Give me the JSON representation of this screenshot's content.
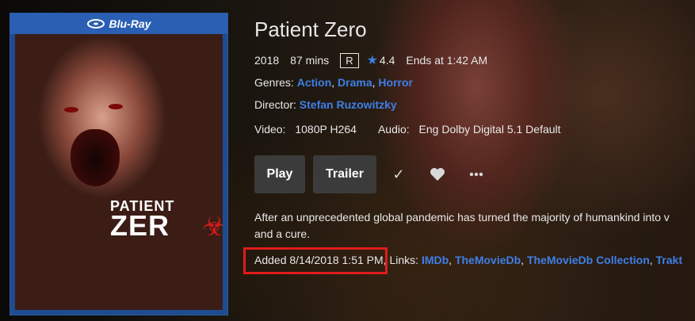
{
  "poster": {
    "format_label": "Blu-Ray",
    "title_line1": "PATIENT",
    "title_line2": "ZER"
  },
  "movie": {
    "title": "Patient Zero",
    "year": "2018",
    "runtime": "87 mins",
    "rating": "R",
    "community_rating": "4.4",
    "ends_at": "Ends at 1:42 AM",
    "genres_label": "Genres:",
    "genres": [
      "Action",
      "Drama",
      "Horror"
    ],
    "director_label": "Director:",
    "director": "Stefan Ruzowitzky",
    "video_label": "Video:",
    "video": "1080P H264",
    "audio_label": "Audio:",
    "audio": "Eng Dolby Digital 5.1 Default",
    "overview_line1": "After an unprecedented global pandemic has turned the majority of humankind into v",
    "overview_line2": "and a cure.",
    "added": "Added 8/14/2018 1:51 PM,",
    "links_label": "Links:",
    "links": [
      "IMDb",
      "TheMovieDb",
      "TheMovieDb Collection",
      "Trakt"
    ]
  },
  "actions": {
    "play_label": "Play",
    "trailer_label": "Trailer",
    "watched_icon": "checkmark-icon",
    "favorite_icon": "heart-icon",
    "more_icon": "more-icon"
  },
  "colors": {
    "link": "#3f7fe8",
    "highlight": "#e01c1c",
    "button_bg": "#3b3b3b"
  }
}
